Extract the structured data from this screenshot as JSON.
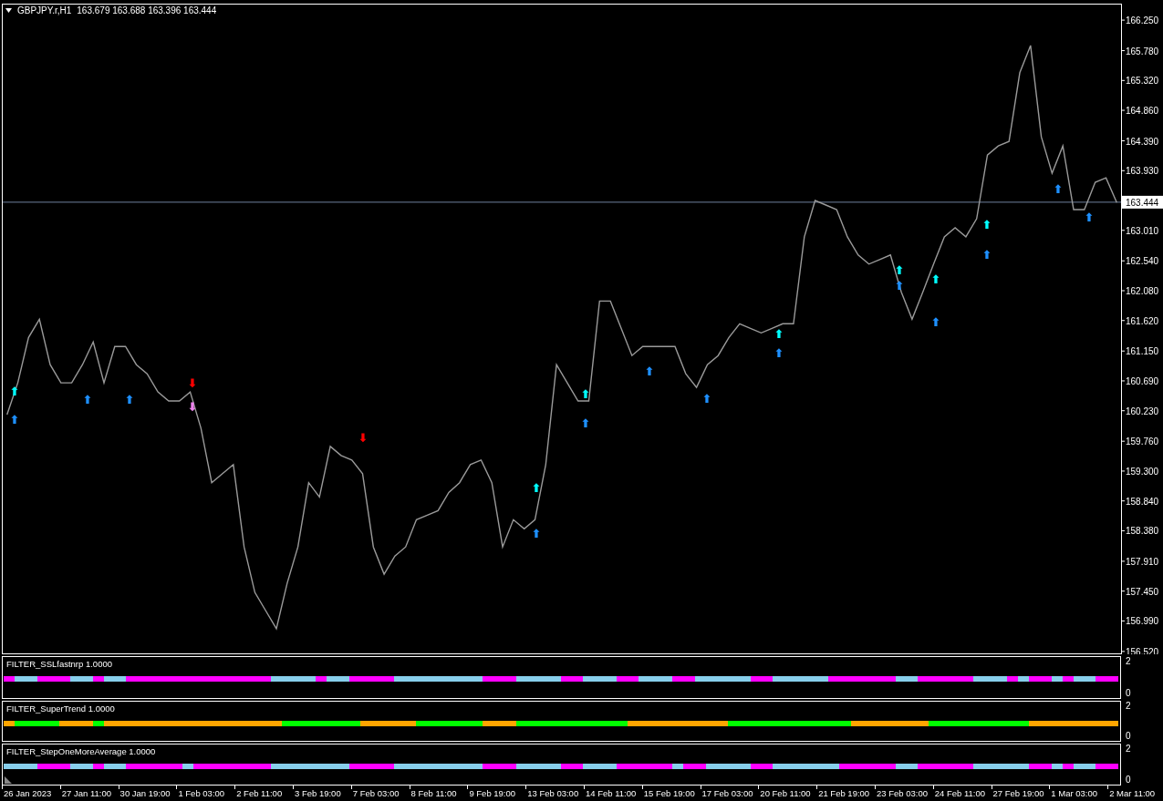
{
  "chart": {
    "symbol": "GBPJPY.r,H1",
    "ohlc": "163.679 163.688 163.396 163.444",
    "signals": [
      {
        "text": "⬆",
        "color": "#1e90ff"
      },
      {
        "text": "⬆",
        "color": "#00ffff"
      },
      {
        "text": "⬆",
        "color": "#1e90ff"
      },
      {
        "text": "⬆",
        "color": "#1e90ff"
      },
      {
        "text": "⬇",
        "color": "#ff0000"
      },
      {
        "text": "⬇",
        "color": "#ee82ee"
      },
      {
        "text": "⬇",
        "color": "#ff0000"
      },
      {
        "text": "⬆",
        "color": "#1e90ff"
      },
      {
        "text": "⬆",
        "color": "#00ffff"
      },
      {
        "text": "⬆",
        "color": "#1e90ff"
      },
      {
        "text": "⬆",
        "color": "#00ffff"
      },
      {
        "text": "⬆",
        "color": "#1e90ff"
      },
      {
        "text": "⬆",
        "color": "#1e90ff"
      },
      {
        "text": "⬆",
        "color": "#1e90ff"
      },
      {
        "text": "⬆",
        "color": "#00ffff"
      },
      {
        "text": "⬆",
        "color": "#1e90ff"
      },
      {
        "text": "⬆",
        "color": "#00ffff"
      },
      {
        "text": "⬆",
        "color": "#1e90ff"
      },
      {
        "text": "⬆",
        "color": "#00ffff"
      },
      {
        "text": "⬆",
        "color": "#1e90ff"
      },
      {
        "text": "⬆",
        "color": "#00ffff"
      },
      {
        "text": "⬆",
        "color": "#1e90ff"
      },
      {
        "text": "⬆",
        "color": "#1e90ff"
      }
    ],
    "chart_data": {
      "type": "line",
      "categories": [
        null,
        null,
        null,
        null,
        null,
        null,
        null,
        null,
        null,
        null,
        null,
        null,
        null,
        null,
        null,
        null,
        null,
        null,
        null,
        null,
        null,
        null,
        null,
        null,
        null,
        null,
        null,
        null,
        null,
        null,
        null,
        null,
        null,
        null,
        null,
        null,
        null,
        null,
        null,
        null,
        null,
        null,
        null,
        null,
        null,
        null,
        null,
        null,
        null,
        null,
        null,
        null,
        null,
        null,
        null,
        null,
        null,
        null,
        null,
        null,
        null,
        null,
        null,
        null,
        null,
        null,
        null,
        null,
        null,
        null,
        null,
        null,
        null,
        null,
        null,
        null,
        null,
        null,
        null,
        null,
        null,
        null,
        null,
        null,
        null,
        null,
        null,
        null,
        null,
        null,
        null,
        null,
        null,
        null,
        null,
        null,
        null,
        null,
        null,
        null,
        null,
        null,
        null,
        null
      ],
      "ref_lines": [
        {
          "axis": "y",
          "value": 163.444,
          "label": "163.444"
        }
      ],
      "values": [
        160.17,
        160.66,
        161.36,
        161.64,
        160.94,
        160.66,
        160.66,
        160.94,
        161.29,
        160.66,
        161.22,
        161.22,
        160.94,
        160.8,
        160.52,
        160.38,
        160.38,
        160.52,
        159.96,
        159.12,
        159.26,
        159.4,
        158.13,
        157.43,
        157.15,
        156.87,
        157.57,
        158.13,
        159.12,
        158.9,
        159.68,
        159.54,
        159.47,
        159.26,
        158.13,
        157.71,
        157.99,
        158.13,
        158.55,
        158.62,
        158.69,
        158.97,
        159.12,
        159.4,
        159.47,
        159.12,
        158.13,
        158.55,
        158.41,
        158.55,
        159.4,
        160.94,
        160.66,
        160.38,
        160.38,
        161.92,
        161.92,
        161.5,
        161.08,
        161.22,
        161.22,
        161.22,
        161.22,
        160.8,
        160.59,
        160.94,
        161.08,
        161.36,
        161.57,
        161.5,
        161.43,
        161.5,
        161.57,
        161.57,
        162.91,
        163.47,
        163.4,
        163.33,
        162.91,
        162.63,
        162.49,
        162.56,
        162.63,
        162.06,
        161.64,
        162.06,
        162.49,
        162.91,
        163.05,
        162.91,
        163.19,
        164.17,
        164.31,
        164.38,
        165.44,
        165.86,
        164.45,
        163.89,
        164.31,
        163.33,
        163.33,
        163.75,
        163.82,
        163.44
      ],
      "ylim": [
        156.49,
        166.49
      ],
      "yticks": [
        {
          "value": 166.25,
          "label": "166.250"
        },
        {
          "value": 165.78,
          "label": "165.780"
        },
        {
          "value": 165.32,
          "label": "165.320"
        },
        {
          "value": 164.86,
          "label": "164.860"
        },
        {
          "value": 164.39,
          "label": "164.390"
        },
        {
          "value": 163.93,
          "label": "163.930"
        },
        {
          "value": 163.01,
          "label": "163.010"
        },
        {
          "value": 162.54,
          "label": "162.540"
        },
        {
          "value": 162.08,
          "label": "162.080"
        },
        {
          "value": 161.62,
          "label": "161.620"
        },
        {
          "value": 161.15,
          "label": "161.150"
        },
        {
          "value": 160.69,
          "label": "160.690"
        },
        {
          "value": 160.23,
          "label": "160.230"
        },
        {
          "value": 159.76,
          "label": "159.760"
        },
        {
          "value": 159.3,
          "label": "159.300"
        },
        {
          "value": 158.84,
          "label": "158.840"
        },
        {
          "value": 158.38,
          "label": "158.380"
        },
        {
          "value": 157.91,
          "label": "157.910"
        },
        {
          "value": 157.45,
          "label": "157.450"
        },
        {
          "value": 156.99,
          "label": "156.990"
        },
        {
          "value": 156.52,
          "label": "156.520"
        }
      ]
    }
  },
  "time_axis": [
    "26 Jan 2023",
    "27 Jan 11:00",
    "30 Jan 19:00",
    "1 Feb 03:00",
    "2 Feb 11:00",
    "3 Feb 19:00",
    "7 Feb 03:00",
    "8 Feb 11:00",
    "9 Feb 19:00",
    "13 Feb 03:00",
    "14 Feb 11:00",
    "15 Feb 19:00",
    "17 Feb 03:00",
    "20 Feb 11:00",
    "21 Feb 19:00",
    "23 Feb 03:00",
    "24 Feb 11:00",
    "27 Feb 19:00",
    "1 Mar 03:00",
    "2 Mar 11:00"
  ],
  "indicators": [
    {
      "title": "FILTER_SSLfastnrp 1.0000",
      "yticks": [
        "2",
        "0"
      ],
      "cells": [
        {
          "color": "#ff00ff"
        },
        {
          "color": "#87ceeb"
        },
        {
          "color": "#87ceeb"
        },
        {
          "color": "#ff00ff"
        },
        {
          "color": "#ff00ff"
        },
        {
          "color": "#ff00ff"
        },
        {
          "color": "#87ceeb"
        },
        {
          "color": "#87ceeb"
        },
        {
          "color": "#ff00ff"
        },
        {
          "color": "#87ceeb"
        },
        {
          "color": "#87ceeb"
        },
        {
          "color": "#ff00ff"
        },
        {
          "color": "#ff00ff"
        },
        {
          "color": "#ff00ff"
        },
        {
          "color": "#ff00ff"
        },
        {
          "color": "#ff00ff"
        },
        {
          "color": "#ff00ff"
        },
        {
          "color": "#ff00ff"
        },
        {
          "color": "#ff00ff"
        },
        {
          "color": "#ff00ff"
        },
        {
          "color": "#ff00ff"
        },
        {
          "color": "#ff00ff"
        },
        {
          "color": "#ff00ff"
        },
        {
          "color": "#ff00ff"
        },
        {
          "color": "#87ceeb"
        },
        {
          "color": "#87ceeb"
        },
        {
          "color": "#87ceeb"
        },
        {
          "color": "#87ceeb"
        },
        {
          "color": "#ff00ff"
        },
        {
          "color": "#87ceeb"
        },
        {
          "color": "#87ceeb"
        },
        {
          "color": "#ff00ff"
        },
        {
          "color": "#ff00ff"
        },
        {
          "color": "#ff00ff"
        },
        {
          "color": "#ff00ff"
        },
        {
          "color": "#87ceeb"
        },
        {
          "color": "#87ceeb"
        },
        {
          "color": "#87ceeb"
        },
        {
          "color": "#87ceeb"
        },
        {
          "color": "#87ceeb"
        },
        {
          "color": "#87ceeb"
        },
        {
          "color": "#87ceeb"
        },
        {
          "color": "#87ceeb"
        },
        {
          "color": "#ff00ff"
        },
        {
          "color": "#ff00ff"
        },
        {
          "color": "#ff00ff"
        },
        {
          "color": "#87ceeb"
        },
        {
          "color": "#87ceeb"
        },
        {
          "color": "#87ceeb"
        },
        {
          "color": "#87ceeb"
        },
        {
          "color": "#ff00ff"
        },
        {
          "color": "#ff00ff"
        },
        {
          "color": "#87ceeb"
        },
        {
          "color": "#87ceeb"
        },
        {
          "color": "#87ceeb"
        },
        {
          "color": "#ff00ff"
        },
        {
          "color": "#ff00ff"
        },
        {
          "color": "#87ceeb"
        },
        {
          "color": "#87ceeb"
        },
        {
          "color": "#87ceeb"
        },
        {
          "color": "#ff00ff"
        },
        {
          "color": "#ff00ff"
        },
        {
          "color": "#87ceeb"
        },
        {
          "color": "#87ceeb"
        },
        {
          "color": "#87ceeb"
        },
        {
          "color": "#87ceeb"
        },
        {
          "color": "#87ceeb"
        },
        {
          "color": "#ff00ff"
        },
        {
          "color": "#ff00ff"
        },
        {
          "color": "#87ceeb"
        },
        {
          "color": "#87ceeb"
        },
        {
          "color": "#87ceeb"
        },
        {
          "color": "#87ceeb"
        },
        {
          "color": "#87ceeb"
        },
        {
          "color": "#ff00ff"
        },
        {
          "color": "#ff00ff"
        },
        {
          "color": "#ff00ff"
        },
        {
          "color": "#ff00ff"
        },
        {
          "color": "#ff00ff"
        },
        {
          "color": "#ff00ff"
        },
        {
          "color": "#87ceeb"
        },
        {
          "color": "#87ceeb"
        },
        {
          "color": "#ff00ff"
        },
        {
          "color": "#ff00ff"
        },
        {
          "color": "#ff00ff"
        },
        {
          "color": "#ff00ff"
        },
        {
          "color": "#ff00ff"
        },
        {
          "color": "#87ceeb"
        },
        {
          "color": "#87ceeb"
        },
        {
          "color": "#87ceeb"
        },
        {
          "color": "#ff00ff"
        },
        {
          "color": "#87ceeb"
        },
        {
          "color": "#ff00ff"
        },
        {
          "color": "#ff00ff"
        },
        {
          "color": "#87ceeb"
        },
        {
          "color": "#ff00ff"
        },
        {
          "color": "#87ceeb"
        },
        {
          "color": "#87ceeb"
        },
        {
          "color": "#ff00ff"
        },
        {
          "color": "#ff00ff"
        }
      ]
    },
    {
      "title": "FILTER_SuperTrend 1.0000",
      "yticks": [
        "2",
        "0"
      ],
      "cells": [
        {
          "color": "#ffa500"
        },
        {
          "color": "#00ff00"
        },
        {
          "color": "#00ff00"
        },
        {
          "color": "#00ff00"
        },
        {
          "color": "#00ff00"
        },
        {
          "color": "#ffa500"
        },
        {
          "color": "#ffa500"
        },
        {
          "color": "#ffa500"
        },
        {
          "color": "#00ff00"
        },
        {
          "color": "#ffa500"
        },
        {
          "color": "#ffa500"
        },
        {
          "color": "#ffa500"
        },
        {
          "color": "#ffa500"
        },
        {
          "color": "#ffa500"
        },
        {
          "color": "#ffa500"
        },
        {
          "color": "#ffa500"
        },
        {
          "color": "#ffa500"
        },
        {
          "color": "#ffa500"
        },
        {
          "color": "#ffa500"
        },
        {
          "color": "#ffa500"
        },
        {
          "color": "#ffa500"
        },
        {
          "color": "#ffa500"
        },
        {
          "color": "#ffa500"
        },
        {
          "color": "#ffa500"
        },
        {
          "color": "#ffa500"
        },
        {
          "color": "#00ff00"
        },
        {
          "color": "#00ff00"
        },
        {
          "color": "#00ff00"
        },
        {
          "color": "#00ff00"
        },
        {
          "color": "#00ff00"
        },
        {
          "color": "#00ff00"
        },
        {
          "color": "#00ff00"
        },
        {
          "color": "#ffa500"
        },
        {
          "color": "#ffa500"
        },
        {
          "color": "#ffa500"
        },
        {
          "color": "#ffa500"
        },
        {
          "color": "#ffa500"
        },
        {
          "color": "#00ff00"
        },
        {
          "color": "#00ff00"
        },
        {
          "color": "#00ff00"
        },
        {
          "color": "#00ff00"
        },
        {
          "color": "#00ff00"
        },
        {
          "color": "#00ff00"
        },
        {
          "color": "#ffa500"
        },
        {
          "color": "#ffa500"
        },
        {
          "color": "#ffa500"
        },
        {
          "color": "#00ff00"
        },
        {
          "color": "#00ff00"
        },
        {
          "color": "#00ff00"
        },
        {
          "color": "#00ff00"
        },
        {
          "color": "#00ff00"
        },
        {
          "color": "#00ff00"
        },
        {
          "color": "#00ff00"
        },
        {
          "color": "#00ff00"
        },
        {
          "color": "#00ff00"
        },
        {
          "color": "#00ff00"
        },
        {
          "color": "#ffa500"
        },
        {
          "color": "#ffa500"
        },
        {
          "color": "#ffa500"
        },
        {
          "color": "#ffa500"
        },
        {
          "color": "#ffa500"
        },
        {
          "color": "#ffa500"
        },
        {
          "color": "#ffa500"
        },
        {
          "color": "#ffa500"
        },
        {
          "color": "#ffa500"
        },
        {
          "color": "#00ff00"
        },
        {
          "color": "#00ff00"
        },
        {
          "color": "#00ff00"
        },
        {
          "color": "#00ff00"
        },
        {
          "color": "#00ff00"
        },
        {
          "color": "#00ff00"
        },
        {
          "color": "#00ff00"
        },
        {
          "color": "#00ff00"
        },
        {
          "color": "#00ff00"
        },
        {
          "color": "#00ff00"
        },
        {
          "color": "#00ff00"
        },
        {
          "color": "#ffa500"
        },
        {
          "color": "#ffa500"
        },
        {
          "color": "#ffa500"
        },
        {
          "color": "#ffa500"
        },
        {
          "color": "#ffa500"
        },
        {
          "color": "#ffa500"
        },
        {
          "color": "#ffa500"
        },
        {
          "color": "#00ff00"
        },
        {
          "color": "#00ff00"
        },
        {
          "color": "#00ff00"
        },
        {
          "color": "#00ff00"
        },
        {
          "color": "#00ff00"
        },
        {
          "color": "#00ff00"
        },
        {
          "color": "#00ff00"
        },
        {
          "color": "#00ff00"
        },
        {
          "color": "#00ff00"
        },
        {
          "color": "#ffa500"
        },
        {
          "color": "#ffa500"
        },
        {
          "color": "#ffa500"
        },
        {
          "color": "#ffa500"
        },
        {
          "color": "#ffa500"
        },
        {
          "color": "#ffa500"
        },
        {
          "color": "#ffa500"
        },
        {
          "color": "#ffa500"
        }
      ]
    },
    {
      "title": "FILTER_StepOneMoreAverage 1.0000",
      "yticks": [
        "2",
        "0"
      ],
      "cells": [
        {
          "color": "#87ceeb"
        },
        {
          "color": "#87ceeb"
        },
        {
          "color": "#87ceeb"
        },
        {
          "color": "#ff00ff"
        },
        {
          "color": "#ff00ff"
        },
        {
          "color": "#ff00ff"
        },
        {
          "color": "#87ceeb"
        },
        {
          "color": "#87ceeb"
        },
        {
          "color": "#ff00ff"
        },
        {
          "color": "#87ceeb"
        },
        {
          "color": "#87ceeb"
        },
        {
          "color": "#ff00ff"
        },
        {
          "color": "#ff00ff"
        },
        {
          "color": "#ff00ff"
        },
        {
          "color": "#ff00ff"
        },
        {
          "color": "#ff00ff"
        },
        {
          "color": "#87ceeb"
        },
        {
          "color": "#ff00ff"
        },
        {
          "color": "#ff00ff"
        },
        {
          "color": "#ff00ff"
        },
        {
          "color": "#ff00ff"
        },
        {
          "color": "#ff00ff"
        },
        {
          "color": "#ff00ff"
        },
        {
          "color": "#ff00ff"
        },
        {
          "color": "#87ceeb"
        },
        {
          "color": "#87ceeb"
        },
        {
          "color": "#87ceeb"
        },
        {
          "color": "#87ceeb"
        },
        {
          "color": "#87ceeb"
        },
        {
          "color": "#87ceeb"
        },
        {
          "color": "#87ceeb"
        },
        {
          "color": "#ff00ff"
        },
        {
          "color": "#ff00ff"
        },
        {
          "color": "#ff00ff"
        },
        {
          "color": "#ff00ff"
        },
        {
          "color": "#87ceeb"
        },
        {
          "color": "#87ceeb"
        },
        {
          "color": "#87ceeb"
        },
        {
          "color": "#87ceeb"
        },
        {
          "color": "#87ceeb"
        },
        {
          "color": "#87ceeb"
        },
        {
          "color": "#87ceeb"
        },
        {
          "color": "#87ceeb"
        },
        {
          "color": "#ff00ff"
        },
        {
          "color": "#ff00ff"
        },
        {
          "color": "#ff00ff"
        },
        {
          "color": "#87ceeb"
        },
        {
          "color": "#87ceeb"
        },
        {
          "color": "#87ceeb"
        },
        {
          "color": "#87ceeb"
        },
        {
          "color": "#ff00ff"
        },
        {
          "color": "#ff00ff"
        },
        {
          "color": "#87ceeb"
        },
        {
          "color": "#87ceeb"
        },
        {
          "color": "#87ceeb"
        },
        {
          "color": "#ff00ff"
        },
        {
          "color": "#ff00ff"
        },
        {
          "color": "#ff00ff"
        },
        {
          "color": "#ff00ff"
        },
        {
          "color": "#ff00ff"
        },
        {
          "color": "#87ceeb"
        },
        {
          "color": "#ff00ff"
        },
        {
          "color": "#ff00ff"
        },
        {
          "color": "#87ceeb"
        },
        {
          "color": "#87ceeb"
        },
        {
          "color": "#87ceeb"
        },
        {
          "color": "#87ceeb"
        },
        {
          "color": "#ff00ff"
        },
        {
          "color": "#ff00ff"
        },
        {
          "color": "#87ceeb"
        },
        {
          "color": "#87ceeb"
        },
        {
          "color": "#87ceeb"
        },
        {
          "color": "#87ceeb"
        },
        {
          "color": "#87ceeb"
        },
        {
          "color": "#87ceeb"
        },
        {
          "color": "#ff00ff"
        },
        {
          "color": "#ff00ff"
        },
        {
          "color": "#ff00ff"
        },
        {
          "color": "#ff00ff"
        },
        {
          "color": "#ff00ff"
        },
        {
          "color": "#87ceeb"
        },
        {
          "color": "#87ceeb"
        },
        {
          "color": "#ff00ff"
        },
        {
          "color": "#ff00ff"
        },
        {
          "color": "#ff00ff"
        },
        {
          "color": "#ff00ff"
        },
        {
          "color": "#ff00ff"
        },
        {
          "color": "#87ceeb"
        },
        {
          "color": "#87ceeb"
        },
        {
          "color": "#87ceeb"
        },
        {
          "color": "#87ceeb"
        },
        {
          "color": "#87ceeb"
        },
        {
          "color": "#ff00ff"
        },
        {
          "color": "#ff00ff"
        },
        {
          "color": "#87ceeb"
        },
        {
          "color": "#ff00ff"
        },
        {
          "color": "#87ceeb"
        },
        {
          "color": "#87ceeb"
        },
        {
          "color": "#ff00ff"
        },
        {
          "color": "#ff00ff"
        }
      ]
    }
  ]
}
